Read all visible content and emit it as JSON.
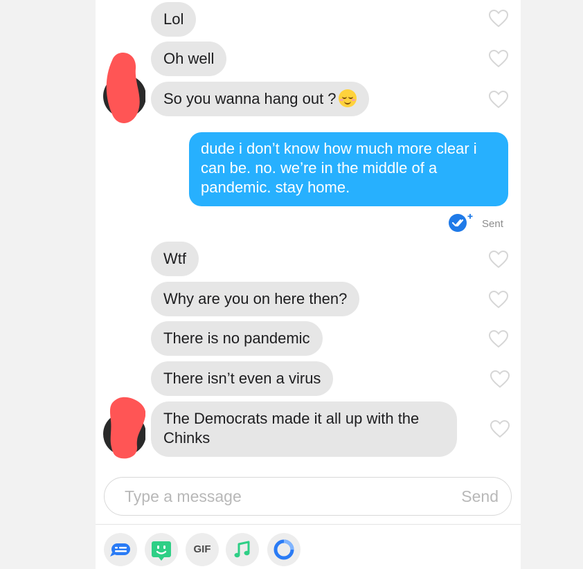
{
  "messages": {
    "lol": "Lol",
    "oh_well": "Oh well",
    "hang_out": "So you wanna hang out ?",
    "my_reply": "dude i don’t know how much more clear i can be. no. we’re in the middle of a pandemic. stay home.",
    "wtf": "Wtf",
    "why": "Why are you on here then?",
    "no_pandemic": "There is no pandemic",
    "no_virus": "There isn’t even a virus",
    "democrats": "The Democrats made it all up with the Chinks"
  },
  "status": {
    "sent_label": "Sent"
  },
  "composer": {
    "placeholder": "Type a message",
    "send_label": "Send"
  },
  "toolbar": {
    "gif_label": "GIF"
  },
  "icons": {
    "like": "heart-outline-icon",
    "read_receipt": "read-receipt-check-icon",
    "tools": [
      "message-bubble-icon",
      "sticker-icon",
      "gif-icon",
      "music-note-icon",
      "ring-icon"
    ]
  },
  "colors": {
    "my_bubble": "#27b0fe",
    "their_bubble": "#e6e6e6",
    "censor_red": "#ff5555",
    "sticker_green": "#2fcf86",
    "music_green": "#2fcf86",
    "ring_blue": "#2a7bf5",
    "receipt_blue": "#1f7ae8"
  }
}
